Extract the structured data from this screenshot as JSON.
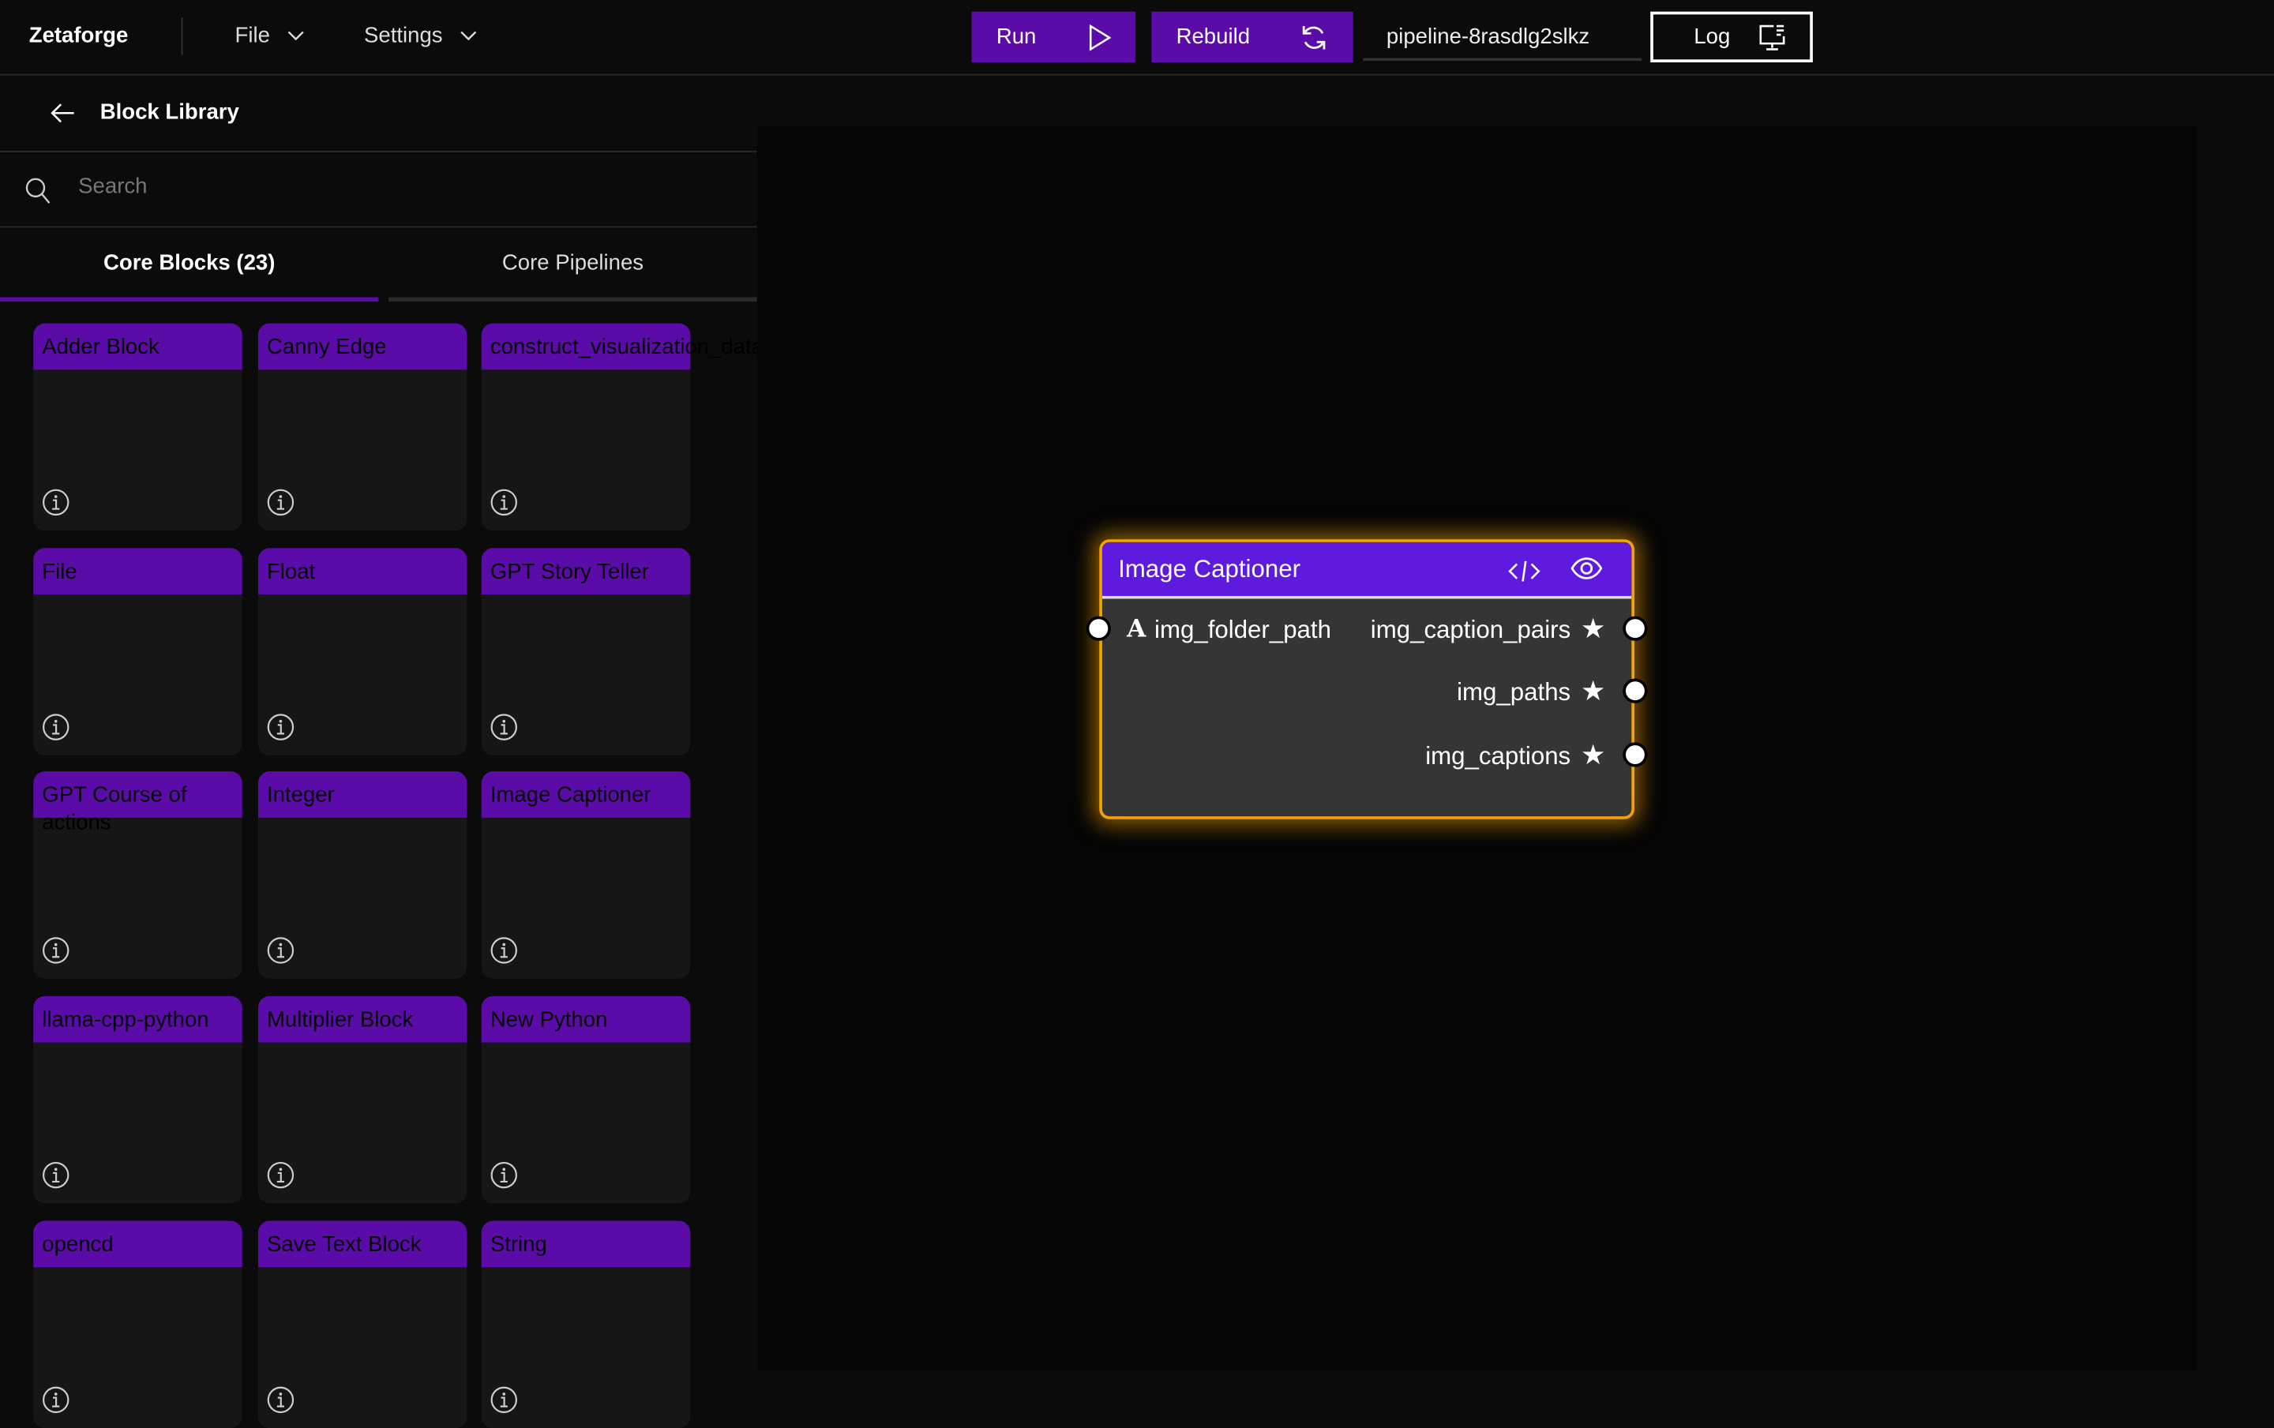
{
  "app": {
    "title": "Zetaforge"
  },
  "menu": {
    "file": "File",
    "settings": "Settings"
  },
  "toolbar": {
    "run": "Run",
    "rebuild": "Rebuild",
    "pipeline_name": "pipeline-8rasdlg2slkz",
    "log": "Log"
  },
  "library": {
    "title": "Block Library",
    "search_placeholder": "Search",
    "tabs": [
      {
        "label": "Core Blocks (23)",
        "active": true
      },
      {
        "label": "Core Pipelines",
        "active": false
      }
    ],
    "blocks": [
      "Adder Block",
      "Canny Edge",
      "construct_visualization_data",
      "File",
      "Float",
      "GPT Story Teller",
      "GPT Course of actions",
      "Integer",
      "Image Captioner",
      "llama-cpp-python",
      "Multiplier Block",
      "New Python",
      "opencd",
      "Save Text Block",
      "String"
    ]
  },
  "node": {
    "title": "Image Captioner",
    "inputs": [
      {
        "name": "img_folder_path",
        "type_icon": "text-icon"
      }
    ],
    "outputs": [
      {
        "name": "img_caption_pairs"
      },
      {
        "name": "img_paths"
      },
      {
        "name": "img_captions"
      }
    ]
  },
  "colors": {
    "accent": "#5a0ba8",
    "node_header": "#5e1adf",
    "node_border": "#f5a300",
    "background": "#0b0b0b"
  }
}
